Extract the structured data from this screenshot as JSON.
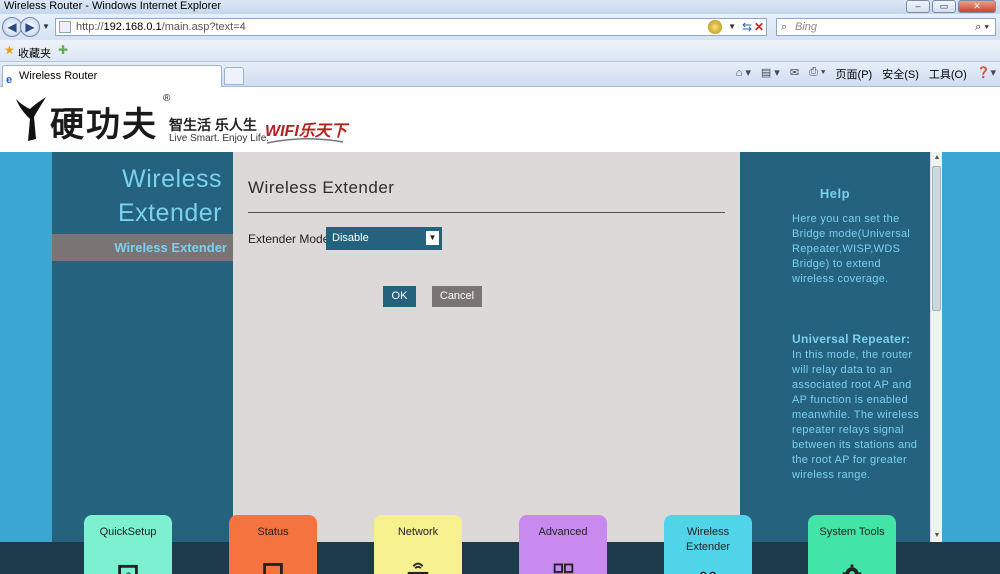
{
  "browser": {
    "window_title": "Wireless Router - Windows Internet Explorer",
    "url_prefix": "http://",
    "url_host": "192.168.0.1",
    "url_path": "/main.asp?text=4",
    "search_placeholder": "Bing",
    "favorites_label": "收藏夹",
    "tab_title": "Wireless Router",
    "commands": [
      "页面(P)",
      "安全(S)",
      "工具(O)"
    ],
    "icons": [
      "back-icon",
      "forward-icon",
      "refresh-icon",
      "stop-icon",
      "search-icon",
      "favorites-star-icon",
      "home-icon",
      "feeds-icon",
      "mail-icon",
      "print-icon",
      "help-icon"
    ]
  },
  "brand": {
    "name_cn": "硬功夫",
    "registered": "®",
    "slogan_cn": "智生活  乐人生",
    "slogan_en": "Live Smart. Enjoy Life.",
    "wifi": "WIFI乐天下"
  },
  "sidebar": {
    "section_title_line1": "Wireless",
    "section_title_line2": "Extender",
    "active_item": "Wireless Extender"
  },
  "content": {
    "title": "Wireless Extender",
    "mode_label": "Extender Mode",
    "mode_value": "Disable",
    "ok_label": "OK",
    "cancel_label": "Cancel"
  },
  "help": {
    "title": "Help",
    "intro": "Here you can set the Bridge mode(Universal Repeater,WISP,WDS Bridge) to extend wireless coverage.",
    "sub_title": "Universal Repeater",
    "sub_text": "In this mode, the router will relay data to an associated root AP and AP function is enabled meanwhile. The wireless repeater relays signal between its stations and the root AP for greater wireless range."
  },
  "menu": [
    {
      "label": "QuickSetup",
      "color": "#7cf0d0",
      "icon": "quicksetup-icon"
    },
    {
      "label": "Status",
      "color": "#f5733f",
      "icon": "status-icon"
    },
    {
      "label": "Network",
      "color": "#f6f08e",
      "icon": "network-icon"
    },
    {
      "label": "Advanced",
      "color": "#c98af0",
      "icon": "advanced-icon"
    },
    {
      "label": "Wireless Extender",
      "color": "#4fd4ea",
      "icon": "wireless-extender-icon"
    },
    {
      "label": "System Tools",
      "color": "#43e4a7",
      "icon": "system-tools-icon"
    }
  ],
  "colors": {
    "panel_dark": "#24627d",
    "panel_light": "#3aa6d1",
    "content_bg": "#ddd9d8",
    "accent_text": "#7ad1ef",
    "active_item_bg": "#7b7474"
  }
}
